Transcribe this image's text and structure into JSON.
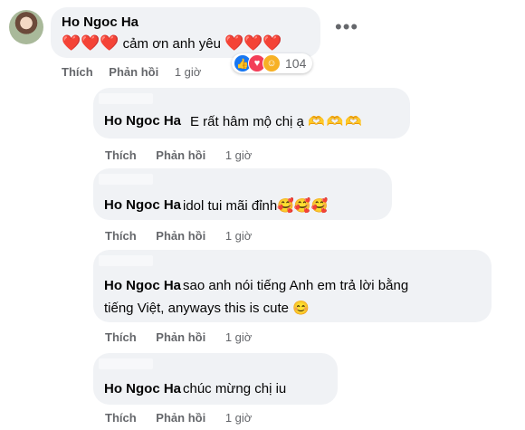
{
  "main": {
    "author": "Ho Ngoc Ha",
    "hearts_left": "❤️❤️❤️",
    "text": " cảm ơn anh yêu ",
    "hearts_right": "❤️❤️❤️",
    "more": "•••",
    "like": "Thích",
    "reply": "Phản hồi",
    "time": "1 giờ",
    "reaction_count": "104",
    "reaction_icons": [
      "like-icon",
      "love-icon",
      "care-icon"
    ]
  },
  "replies": [
    {
      "author": "Ho Ngoc Ha",
      "text": "E rất hâm mộ chị ạ ",
      "emoji": "🫶🫶🫶",
      "like": "Thích",
      "reply": "Phản hồi",
      "time": "1 giờ"
    },
    {
      "author": "Ho Ngoc Ha",
      "text": " idol tui mãi đỉnh",
      "emoji": "🥰🥰🥰",
      "like": "Thích",
      "reply": "Phản hồi",
      "time": "1 giờ"
    },
    {
      "author": "Ho Ngoc Ha",
      "text_line1": " sao anh nói tiếng Anh em trả lời bằng",
      "text_line2": "tiếng Việt, anyways this is cute ",
      "emoji": "😊",
      "like": "Thích",
      "reply": "Phản hồi",
      "time": "1 giờ"
    },
    {
      "author": "Ho Ngoc Ha",
      "text": " chúc mừng chị iu",
      "like": "Thích",
      "reply": "Phản hồi",
      "time": "1 giờ"
    }
  ],
  "colors": {
    "bubble": "#f0f2f5",
    "secondary_text": "#65676b",
    "heart": "#e8112d",
    "like": "#1877f2"
  }
}
